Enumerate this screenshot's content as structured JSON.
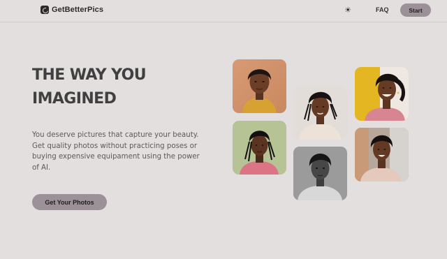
{
  "header": {
    "brand_name": "GetBetterPics",
    "brand_icon": "logo-icon",
    "theme_icon": "sun-icon",
    "faq_label": "FAQ",
    "start_label": "Start"
  },
  "hero": {
    "title_line1": "THE WAY YOU",
    "title_line2": "IMAGINED",
    "description": "You deserve pictures that capture your beauty. Get quality photos without practicing poses or buying expensive equipament using the power of AI.",
    "cta_label": "Get Your Photos"
  },
  "colors": {
    "background": "#e4dfdf",
    "accent_button": "#9c9099",
    "text_dark": "#404040"
  },
  "photos": [
    {
      "id": "portrait-orange-bg",
      "icon": "portrait-photo"
    },
    {
      "id": "portrait-green-bg",
      "icon": "portrait-photo"
    },
    {
      "id": "portrait-light-bg",
      "icon": "portrait-photo"
    },
    {
      "id": "portrait-grayscale",
      "icon": "portrait-photo"
    },
    {
      "id": "portrait-yellow-bg",
      "icon": "portrait-photo"
    },
    {
      "id": "portrait-cafe-bg",
      "icon": "portrait-photo"
    }
  ]
}
